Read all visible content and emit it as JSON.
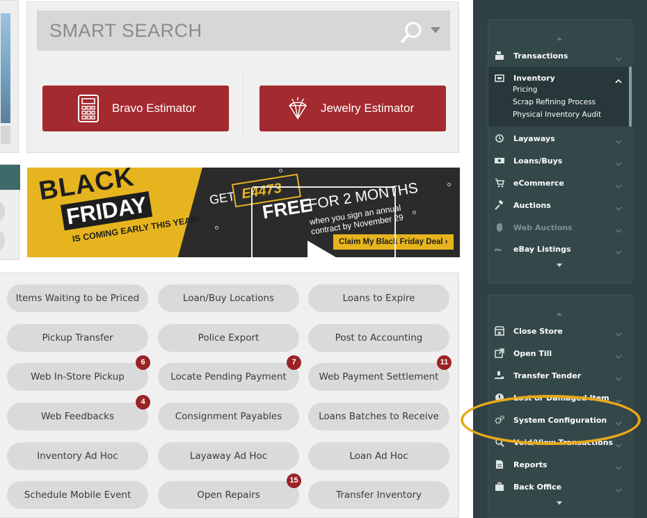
{
  "search": {
    "placeholder": "SMART SEARCH"
  },
  "estimators": {
    "bravo_label": "Bravo Estimator",
    "jewelry_label": "Jewelry Estimator"
  },
  "banner": {
    "black": "BLACK",
    "friday": "FRIDAY",
    "coming_early": "IS COMING EARLY THIS YEAR!",
    "get": "GET",
    "logo": "E4473",
    "free": "FREE",
    "months": "FOR 2 MONTHS",
    "sign_up": "when you sign an annual contract by November 29",
    "cta": "Claim My Black Friday Deal ›"
  },
  "quick_links": [
    {
      "label": "Items Waiting to be Priced",
      "badge": null
    },
    {
      "label": "Loan/Buy Locations",
      "badge": null
    },
    {
      "label": "Loans to Expire",
      "badge": null
    },
    {
      "label": "Pickup Transfer",
      "badge": null
    },
    {
      "label": "Police Export",
      "badge": null
    },
    {
      "label": "Post to Accounting",
      "badge": null
    },
    {
      "label": "Web In-Store Pickup",
      "badge": "6"
    },
    {
      "label": "Locate Pending Payment",
      "badge": "7"
    },
    {
      "label": "Web Payment Settlement",
      "badge": "11"
    },
    {
      "label": "Web Feedbacks",
      "badge": "4"
    },
    {
      "label": "Consignment Payables",
      "badge": null
    },
    {
      "label": "Loans Batches to Receive",
      "badge": null
    },
    {
      "label": "Inventory Ad Hoc",
      "badge": null
    },
    {
      "label": "Layaway Ad Hoc",
      "badge": null
    },
    {
      "label": "Loan Ad Hoc",
      "badge": null
    },
    {
      "label": "Schedule Mobile Event",
      "badge": null
    },
    {
      "label": "Open Repairs",
      "badge": "15"
    },
    {
      "label": "Transfer Inventory",
      "badge": null
    }
  ],
  "sidebar_top": {
    "items": [
      {
        "label": "Transactions",
        "icon": "register-icon"
      },
      {
        "label": "Inventory",
        "icon": "inventory-icon"
      },
      {
        "label": "Layaways",
        "icon": "history-icon"
      },
      {
        "label": "Loans/Buys",
        "icon": "cash-icon"
      },
      {
        "label": "eCommerce",
        "icon": "cart-icon"
      },
      {
        "label": "Auctions",
        "icon": "gavel-icon"
      },
      {
        "label": "Web Auctions",
        "icon": "mouse-icon"
      },
      {
        "label": "eBay Listings",
        "icon": "ebay-icon"
      }
    ],
    "inventory_sub": [
      "Pricing",
      "Scrap Refining Process",
      "Physical Inventory Audit"
    ]
  },
  "sidebar_bottom": {
    "items": [
      {
        "label": "Close Store",
        "icon": "store-close-icon"
      },
      {
        "label": "Open Till",
        "icon": "external-link-icon"
      },
      {
        "label": "Transfer Tender",
        "icon": "hand-money-icon"
      },
      {
        "label": "Lost or Damaged Item",
        "icon": "alert-icon"
      },
      {
        "label": "System Configuration",
        "icon": "gears-icon"
      },
      {
        "label": "Void/View Transactions",
        "icon": "search-icon"
      },
      {
        "label": "Reports",
        "icon": "report-icon"
      },
      {
        "label": "Back Office",
        "icon": "briefcase-icon"
      }
    ]
  },
  "colors": {
    "estimator_red": "#a32a2e",
    "sidebar_bg": "#2f4143",
    "highlight": "#e8a917",
    "badge_red": "#9b2226"
  }
}
